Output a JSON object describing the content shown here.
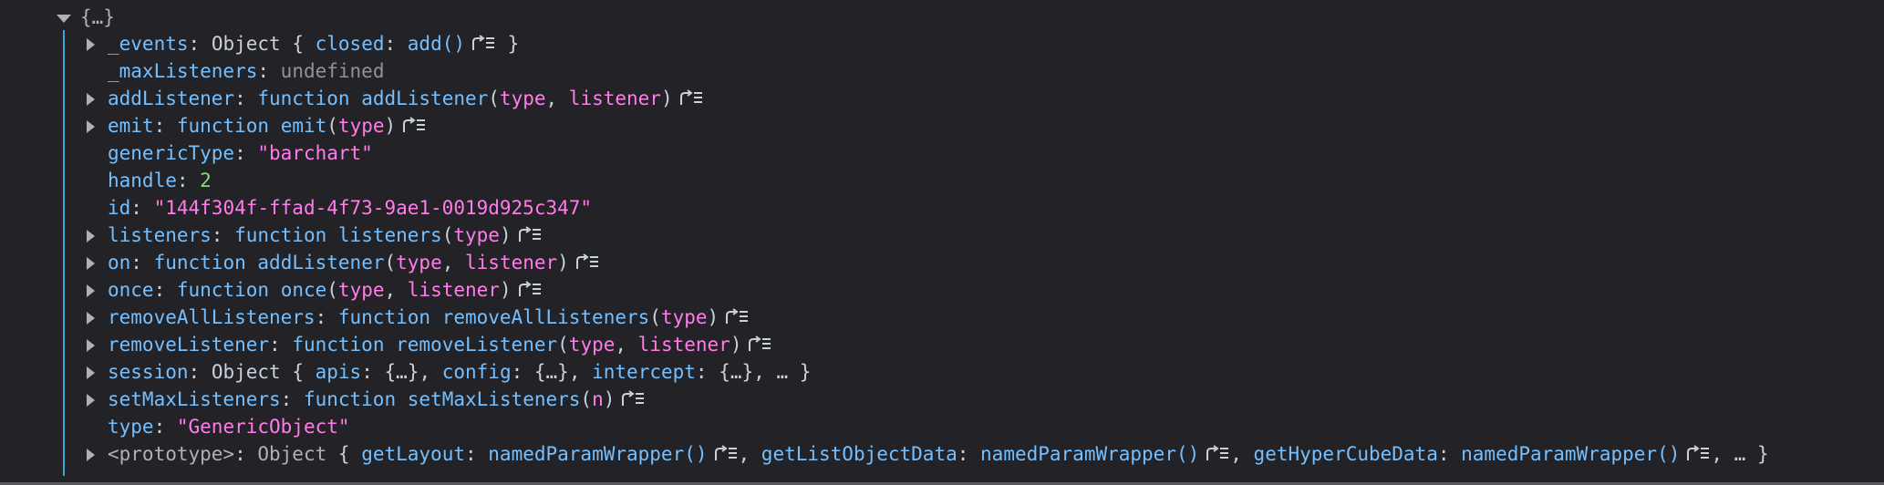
{
  "root_label": "{…}",
  "properties": [
    {
      "key": "_events",
      "kind": "object",
      "expandable": true,
      "type_word": "Object",
      "preview_open": "{ ",
      "preview_items": [
        {
          "name": "closed",
          "value": "add()",
          "jump": true
        }
      ],
      "preview_close": " }"
    },
    {
      "key": "_maxListeners",
      "kind": "undefined",
      "expandable": false,
      "value": "undefined"
    },
    {
      "key": "addListener",
      "kind": "function",
      "expandable": true,
      "keyword": "function",
      "fname": "addListener",
      "params": [
        "type",
        "listener"
      ]
    },
    {
      "key": "emit",
      "kind": "function",
      "expandable": true,
      "keyword": "function",
      "fname": "emit",
      "params": [
        "type"
      ]
    },
    {
      "key": "genericType",
      "kind": "string",
      "expandable": false,
      "value": "\"barchart\""
    },
    {
      "key": "handle",
      "kind": "number",
      "expandable": false,
      "value": "2"
    },
    {
      "key": "id",
      "kind": "string",
      "expandable": false,
      "value": "\"144f304f-ffad-4f73-9ae1-0019d925c347\""
    },
    {
      "key": "listeners",
      "kind": "function",
      "expandable": true,
      "keyword": "function",
      "fname": "listeners",
      "params": [
        "type"
      ]
    },
    {
      "key": "on",
      "kind": "function",
      "expandable": true,
      "keyword": "function",
      "fname": "addListener",
      "params": [
        "type",
        "listener"
      ]
    },
    {
      "key": "once",
      "kind": "function",
      "expandable": true,
      "keyword": "function",
      "fname": "once",
      "params": [
        "type",
        "listener"
      ]
    },
    {
      "key": "removeAllListeners",
      "kind": "function",
      "expandable": true,
      "keyword": "function",
      "fname": "removeAllListeners",
      "params": [
        "type"
      ]
    },
    {
      "key": "removeListener",
      "kind": "function",
      "expandable": true,
      "keyword": "function",
      "fname": "removeListener",
      "params": [
        "type",
        "listener"
      ]
    },
    {
      "key": "session",
      "kind": "object",
      "expandable": true,
      "type_word": "Object",
      "preview_open": "{ ",
      "preview_items": [
        {
          "name": "apis",
          "value": "{…}"
        },
        {
          "name": "config",
          "value": "{…}"
        },
        {
          "name": "intercept",
          "value": "{…}"
        }
      ],
      "preview_tail": "…",
      "preview_close": " }"
    },
    {
      "key": "setMaxListeners",
      "kind": "function",
      "expandable": true,
      "keyword": "function",
      "fname": "setMaxListeners",
      "params": [
        "n"
      ]
    },
    {
      "key": "type",
      "kind": "string",
      "expandable": false,
      "value": "\"GenericObject\""
    },
    {
      "key": "<prototype>",
      "kind": "prototype",
      "expandable": true,
      "type_word": "Object",
      "preview_open": "{ ",
      "preview_items": [
        {
          "name": "getLayout",
          "value": "namedParamWrapper()",
          "jump": true
        },
        {
          "name": "getListObjectData",
          "value": "namedParamWrapper()",
          "jump": true
        },
        {
          "name": "getHyperCubeData",
          "value": "namedParamWrapper()",
          "jump": true
        }
      ],
      "preview_tail": "…",
      "preview_close": " }"
    }
  ],
  "colors": {
    "background": "#232327",
    "key": "#75bfff",
    "string": "#ff7de9",
    "number": "#86de74",
    "undefined": "#939395",
    "punctuation": "#c8d1dc",
    "guide": "#3fa3e0"
  }
}
